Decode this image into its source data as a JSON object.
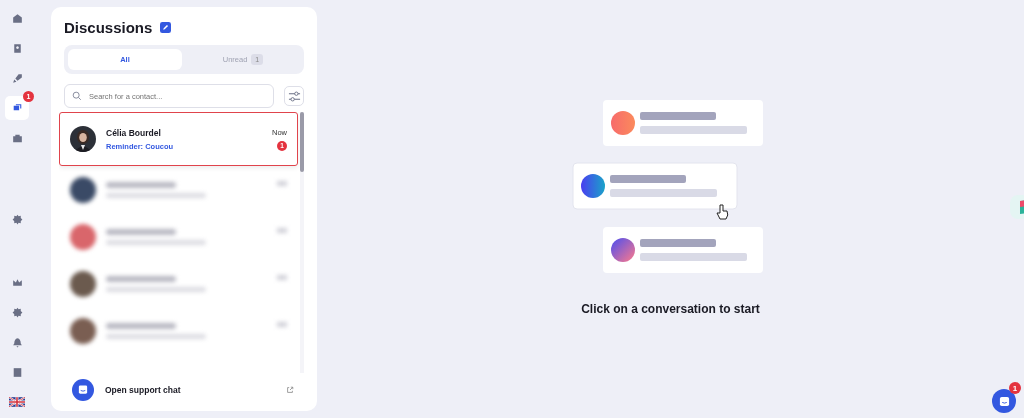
{
  "sidebar": {
    "items": [
      {
        "selected": false
      },
      {
        "selected": false
      },
      {
        "selected": false
      },
      {
        "selected": true,
        "badge": "1"
      },
      {
        "selected": false
      },
      {
        "selected": false
      }
    ]
  },
  "discussions": {
    "title": "Discussions",
    "tabs": [
      {
        "label": "All",
        "selected": true
      },
      {
        "label": "Unread",
        "selected": false,
        "count": "1"
      }
    ],
    "search": {
      "placeholder": "Search for a contact..."
    },
    "contacts": [
      {
        "kind": "contact",
        "name": "Célia Bourdel",
        "preview": "Reminder: Coucou",
        "time": "Now",
        "unread": "1",
        "selected": true
      },
      {
        "kind": "blurred",
        "selected": false
      },
      {
        "kind": "blurred",
        "selected": false
      },
      {
        "kind": "blurred",
        "selected": false
      },
      {
        "kind": "blurred",
        "selected": false
      }
    ],
    "support": {
      "label": "Open support chat"
    }
  },
  "empty_state": {
    "message": "Click on a conversation to start"
  },
  "chat_launcher": {
    "badge": "1"
  }
}
